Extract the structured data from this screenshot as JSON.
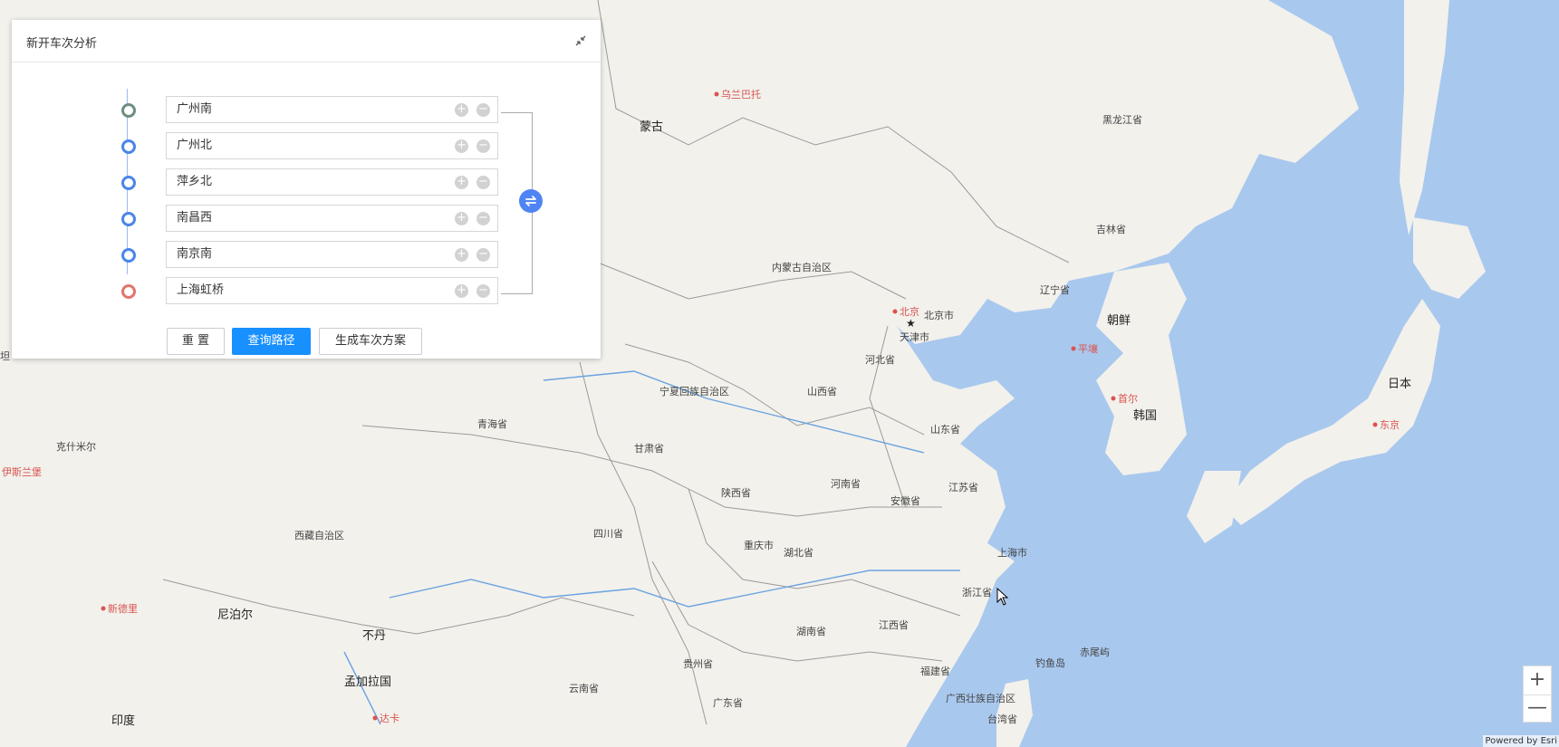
{
  "panel": {
    "title": "新开车次分析",
    "stops": [
      {
        "name": "广州南",
        "role": "start"
      },
      {
        "name": "广州北",
        "role": "via"
      },
      {
        "name": "萍乡北",
        "role": "via"
      },
      {
        "name": "南昌西",
        "role": "via"
      },
      {
        "name": "南京南",
        "role": "via"
      },
      {
        "name": "上海虹桥",
        "role": "end"
      }
    ],
    "add_symbol": "+",
    "remove_symbol": "−",
    "buttons": {
      "reset": "重 置",
      "query": "查询路径",
      "generate": "生成车次方案"
    }
  },
  "map": {
    "labels": [
      {
        "text": "乌兰巴托",
        "kind": "capital"
      },
      {
        "text": "蒙古",
        "kind": "country"
      },
      {
        "text": "黑龙江省",
        "kind": "region"
      },
      {
        "text": "吉林省",
        "kind": "region"
      },
      {
        "text": "内蒙古自治区",
        "kind": "region"
      },
      {
        "text": "辽宁省",
        "kind": "region"
      },
      {
        "text": "朝鲜",
        "kind": "country"
      },
      {
        "text": "北京",
        "kind": "capital"
      },
      {
        "text": "北京市",
        "kind": "region"
      },
      {
        "text": "天津市",
        "kind": "region"
      },
      {
        "text": "平壤",
        "kind": "capital"
      },
      {
        "text": "河北省",
        "kind": "region"
      },
      {
        "text": "首尔",
        "kind": "capital"
      },
      {
        "text": "日本",
        "kind": "country"
      },
      {
        "text": "韩国",
        "kind": "country"
      },
      {
        "text": "宁夏回族自治区",
        "kind": "region"
      },
      {
        "text": "山西省",
        "kind": "region"
      },
      {
        "text": "东京",
        "kind": "capital"
      },
      {
        "text": "青海省",
        "kind": "region"
      },
      {
        "text": "山东省",
        "kind": "region"
      },
      {
        "text": "甘肃省",
        "kind": "region"
      },
      {
        "text": "伊斯兰堡",
        "kind": "capital"
      },
      {
        "text": "河南省",
        "kind": "region"
      },
      {
        "text": "陕西省",
        "kind": "region"
      },
      {
        "text": "江苏省",
        "kind": "region"
      },
      {
        "text": "安徽省",
        "kind": "region"
      },
      {
        "text": "西藏自治区",
        "kind": "region"
      },
      {
        "text": "四川省",
        "kind": "region"
      },
      {
        "text": "重庆市",
        "kind": "region"
      },
      {
        "text": "上海市",
        "kind": "region"
      },
      {
        "text": "湖北省",
        "kind": "region"
      },
      {
        "text": "浙江省",
        "kind": "region"
      },
      {
        "text": "新德里",
        "kind": "capital"
      },
      {
        "text": "尼泊尔",
        "kind": "country"
      },
      {
        "text": "不丹",
        "kind": "country"
      },
      {
        "text": "湖南省",
        "kind": "region"
      },
      {
        "text": "江西省",
        "kind": "region"
      },
      {
        "text": "钓鱼岛",
        "kind": "region"
      },
      {
        "text": "赤尾屿",
        "kind": "region"
      },
      {
        "text": "贵州省",
        "kind": "region"
      },
      {
        "text": "福建省",
        "kind": "region"
      },
      {
        "text": "孟加拉国",
        "kind": "country"
      },
      {
        "text": "云南省",
        "kind": "region"
      },
      {
        "text": "广东省",
        "kind": "region"
      },
      {
        "text": "广西壮族自治区",
        "kind": "region"
      },
      {
        "text": "印度",
        "kind": "country"
      },
      {
        "text": "达卡",
        "kind": "capital"
      },
      {
        "text": "台湾省",
        "kind": "region"
      },
      {
        "text": "坦",
        "kind": "region"
      },
      {
        "text": "克什米尔",
        "kind": "region"
      }
    ],
    "zoom_in": "+",
    "zoom_out": "—",
    "attribution": "Powered by Esri"
  },
  "colors": {
    "land": "#f2f1ec",
    "water": "#a9c8ee",
    "accent": "#1890ff",
    "start_marker": "#6d8f80",
    "via_marker": "#4a86e8",
    "end_marker": "#e0766b"
  }
}
